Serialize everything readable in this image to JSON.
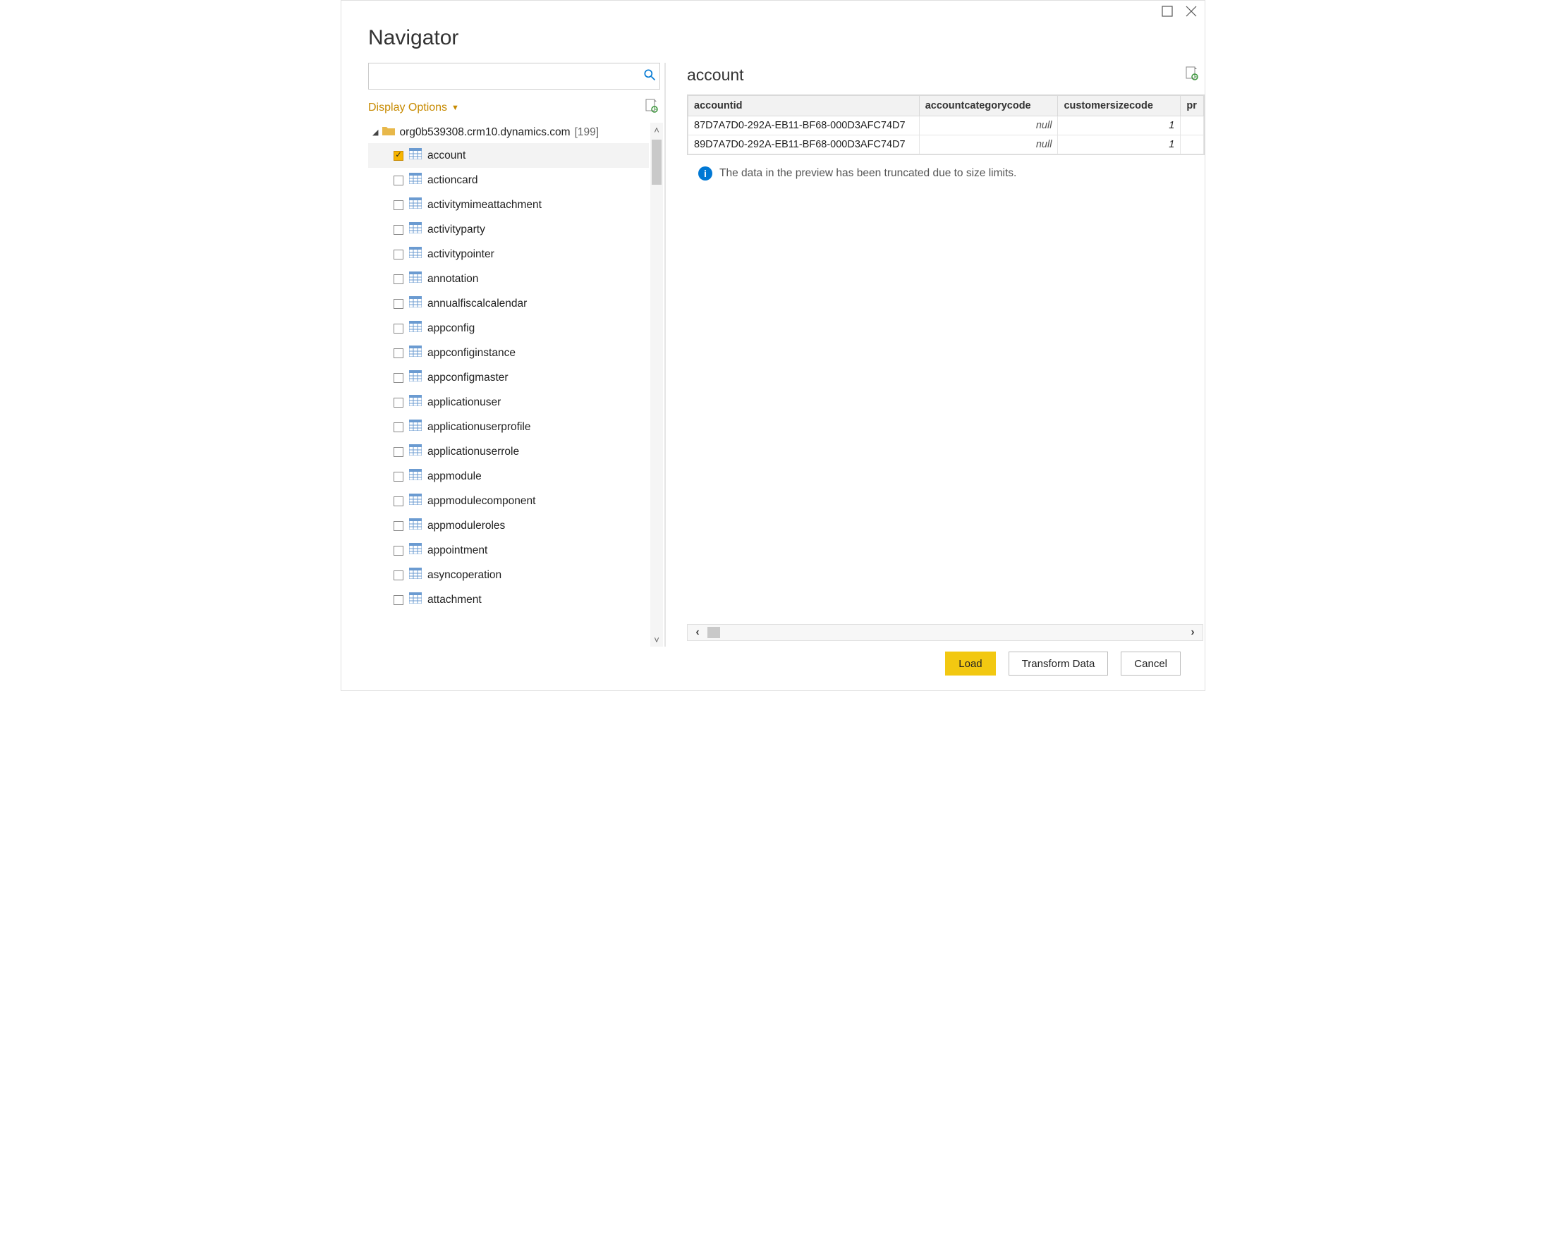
{
  "window": {
    "title": "Navigator"
  },
  "search": {
    "placeholder": ""
  },
  "displayOptions": {
    "label": "Display Options"
  },
  "tree": {
    "root": {
      "label": "org0b539308.crm10.dynamics.com",
      "count": "[199]",
      "expanded": true
    },
    "items": [
      {
        "label": "account",
        "checked": true,
        "selected": true
      },
      {
        "label": "actioncard",
        "checked": false,
        "selected": false
      },
      {
        "label": "activitymimeattachment",
        "checked": false,
        "selected": false
      },
      {
        "label": "activityparty",
        "checked": false,
        "selected": false
      },
      {
        "label": "activitypointer",
        "checked": false,
        "selected": false
      },
      {
        "label": "annotation",
        "checked": false,
        "selected": false
      },
      {
        "label": "annualfiscalcalendar",
        "checked": false,
        "selected": false
      },
      {
        "label": "appconfig",
        "checked": false,
        "selected": false
      },
      {
        "label": "appconfiginstance",
        "checked": false,
        "selected": false
      },
      {
        "label": "appconfigmaster",
        "checked": false,
        "selected": false
      },
      {
        "label": "applicationuser",
        "checked": false,
        "selected": false
      },
      {
        "label": "applicationuserprofile",
        "checked": false,
        "selected": false
      },
      {
        "label": "applicationuserrole",
        "checked": false,
        "selected": false
      },
      {
        "label": "appmodule",
        "checked": false,
        "selected": false
      },
      {
        "label": "appmodulecomponent",
        "checked": false,
        "selected": false
      },
      {
        "label": "appmoduleroles",
        "checked": false,
        "selected": false
      },
      {
        "label": "appointment",
        "checked": false,
        "selected": false
      },
      {
        "label": "asyncoperation",
        "checked": false,
        "selected": false
      },
      {
        "label": "attachment",
        "checked": false,
        "selected": false
      }
    ]
  },
  "preview": {
    "title": "account",
    "columns": [
      "accountid",
      "accountcategorycode",
      "customersizecode",
      "pr"
    ],
    "rows": [
      {
        "accountid": "87D7A7D0-292A-EB11-BF68-000D3AFC74D7",
        "accountcategorycode": "null",
        "customersizecode": "1"
      },
      {
        "accountid": "89D7A7D0-292A-EB11-BF68-000D3AFC74D7",
        "accountcategorycode": "null",
        "customersizecode": "1"
      }
    ],
    "truncated_msg": "The data in the preview has been truncated due to size limits."
  },
  "buttons": {
    "load": "Load",
    "transform": "Transform Data",
    "cancel": "Cancel"
  }
}
